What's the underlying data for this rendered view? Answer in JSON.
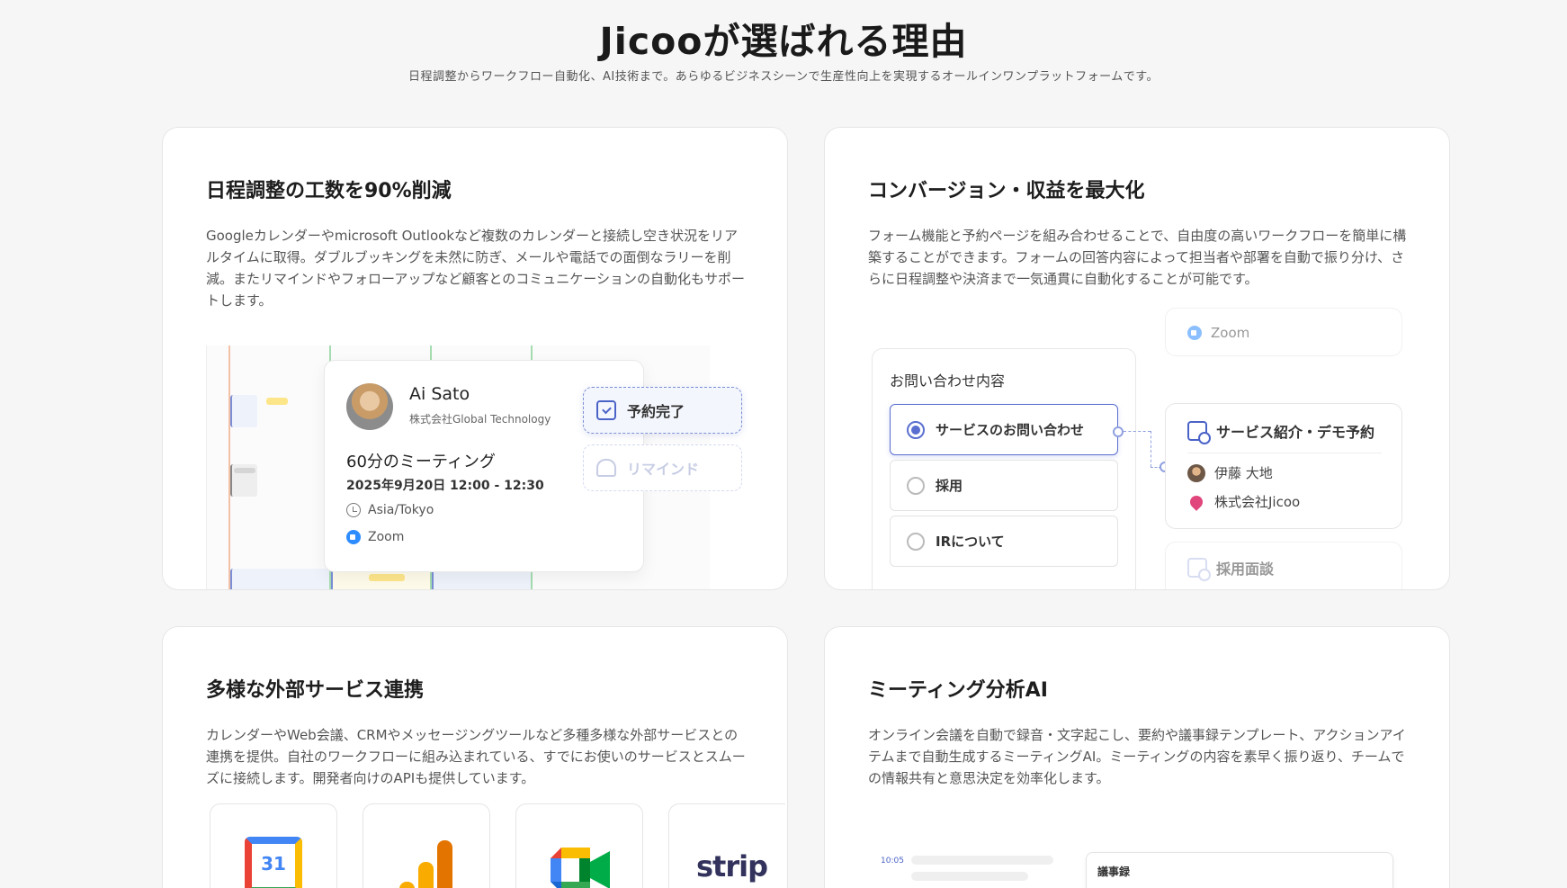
{
  "hero": {
    "title": "Jicooが選ばれる理由",
    "subtitle": "日程調整からワークフロー自動化、AI技術まで。あらゆるビジネスシーンで生産性向上を実現するオールインワンプラットフォームです。"
  },
  "cards": [
    {
      "title": "日程調整の工数を90%削減",
      "description": "Googleカレンダーやmicrosoft Outlookなど複数のカレンダーと接続し空き状況をリアルタイムに取得。ダブルブッキングを未然に防ぎ、メールや電話での面倒なラリーを削減。またリマインドやフォローアップなど顧客とのコミュニケーションの自動化もサポートします。",
      "meeting": {
        "name": "Ai Sato",
        "company": "株式会社Global Technology",
        "topic": "60分のミーティング",
        "datetime": "2025年9月20日 12:00 - 12:30",
        "timezone": "Asia/Tokyo",
        "location": "Zoom"
      },
      "status_done": "予約完了",
      "status_remind": "リマインド"
    },
    {
      "title": "コンバージョン・収益を最大化",
      "description": "フォーム機能と予約ページを組み合わせることで、自由度の高いワークフローを簡単に構築することができます。フォームの回答内容によって担当者や部署を自動で振り分け、さらに日程調整や決済まで一気通貫に自動化することが可能です。",
      "form": {
        "heading": "お問い合わせ内容",
        "options": [
          {
            "label": "サービスのお問い合わせ",
            "selected": true
          },
          {
            "label": "採用",
            "selected": false
          },
          {
            "label": "IRについて",
            "selected": false
          }
        ]
      },
      "services": {
        "top_location": "Zoom",
        "main": {
          "title": "サービス紹介・デモ予約",
          "host": "伊藤 大地",
          "company": "株式会社Jicoo"
        },
        "next_title": "採用面談"
      }
    },
    {
      "title": "多様な外部サービス連携",
      "description": "カレンダーやWeb会議、CRMやメッセージングツールなど多種多様な外部サービスとの連携を提供。自社のワークフローに組み込まれている、すでにお使いのサービスとスムーズに接続します。開発者向けのAPIも提供しています。",
      "integrations": [
        {
          "icon": "google-calendar-icon",
          "text": "31"
        },
        {
          "icon": "google-analytics-icon",
          "text": ""
        },
        {
          "icon": "google-meet-icon",
          "text": ""
        },
        {
          "icon": "stripe-icon",
          "text": "strip"
        }
      ]
    },
    {
      "title": "ミーティング分析AI",
      "description": "オンライン会議を自動で録音・文字起こし、要約や議事録テンプレート、アクションアイテムまで自動生成するミーティングAI。ミーティングの内容を素早く振り返り、チームでの情報共有と意思決定を効率化します。",
      "transcript_time": "10:05",
      "minutes_title": "議事録"
    }
  ],
  "colors": {
    "accent": "#4a63c8",
    "background": "#f6f6f6"
  }
}
